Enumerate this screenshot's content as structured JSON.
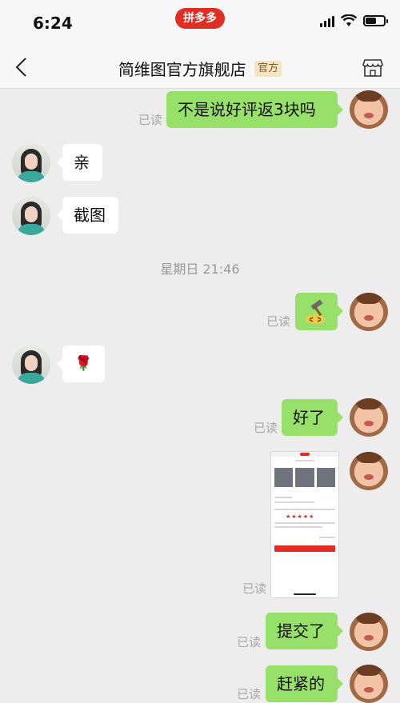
{
  "status_bar": {
    "time": "6:24",
    "app_badge": "拼多多",
    "battery_level": 0.6
  },
  "nav": {
    "store_name": "简维图官方旗舰店",
    "official_tag": "官方"
  },
  "icons": {
    "back": "chevron-left-icon",
    "store": "store-icon"
  },
  "messages": [
    {
      "side": "self",
      "text": "不是说好评返3块吗",
      "read": "已读"
    },
    {
      "side": "shop",
      "text": "亲"
    },
    {
      "side": "shop",
      "text": "截图"
    },
    {
      "side": "self",
      "sticker": "hammer-sticker",
      "read": "已读"
    },
    {
      "side": "shop",
      "text": "🌹"
    },
    {
      "side": "self",
      "text": "好了",
      "read": "已读"
    },
    {
      "side": "self",
      "image": "review-screenshot",
      "read": "已读"
    },
    {
      "side": "self",
      "text": "提交了",
      "read": "已读"
    },
    {
      "side": "self",
      "text": "赶紧的",
      "read": "已读"
    }
  ],
  "timestamp": "星期日 21:46"
}
